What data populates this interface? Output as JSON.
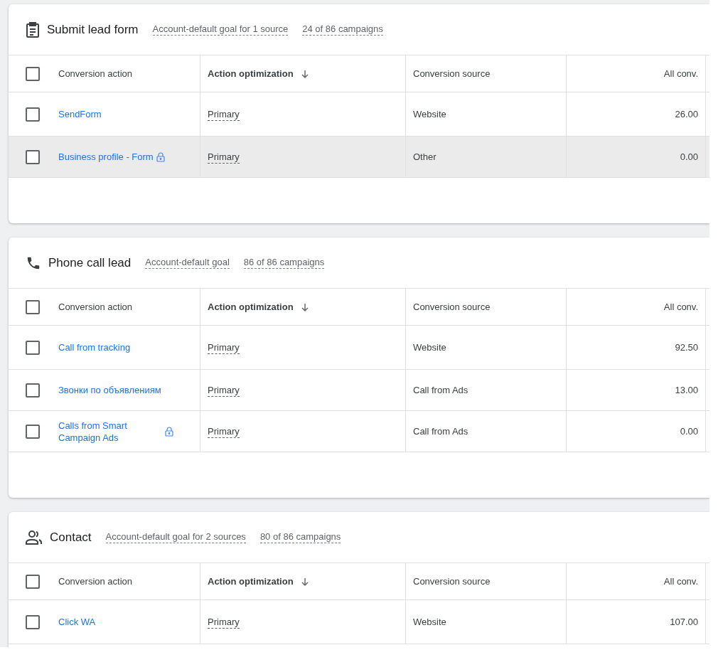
{
  "goals": [
    {
      "kind": "form",
      "title": "Submit lead form",
      "goal_scope": "Account-default goal for 1 source",
      "campaigns": "24 of 86 campaigns",
      "columns": [
        "Conversion action",
        "Action optimization",
        "Conversion source",
        "All conv."
      ],
      "all_checked": false,
      "rows": [
        {
          "action": "SendForm",
          "locked": false,
          "optimization": "Primary",
          "source": "Website",
          "all_conv": "26.00",
          "checked": false,
          "hovered": false
        },
        {
          "action": "Business profile - Form",
          "locked": true,
          "optimization": "Primary",
          "source": "Other",
          "all_conv": "0.00",
          "checked": false,
          "hovered": true
        }
      ]
    },
    {
      "kind": "phone",
      "title": "Phone call lead",
      "goal_scope": "Account-default goal",
      "campaigns": "86 of 86 campaigns",
      "columns": [
        "Conversion action",
        "Action optimization",
        "Conversion source",
        "All conv."
      ],
      "all_checked": false,
      "rows": [
        {
          "action": "Call from tracking",
          "locked": false,
          "optimization": "Primary",
          "source": "Website",
          "all_conv": "92.50",
          "checked": false,
          "hovered": false
        },
        {
          "action": "Звонки по объявлениям",
          "locked": false,
          "optimization": "Primary",
          "source": "Call from Ads",
          "all_conv": "13.00",
          "checked": false,
          "hovered": false
        },
        {
          "action": "Calls from Smart Campaign Ads",
          "locked": true,
          "optimization": "Primary",
          "source": "Call from Ads",
          "all_conv": "0.00",
          "checked": false,
          "hovered": false
        }
      ]
    },
    {
      "kind": "people",
      "title": "Contact",
      "goal_scope": "Account-default goal for 2 sources",
      "campaigns": "80 of 86 campaigns",
      "columns": [
        "Conversion action",
        "Action optimization",
        "Conversion source",
        "All conv."
      ],
      "all_checked": false,
      "rows": [
        {
          "action": "Click WA",
          "locked": false,
          "optimization": "Primary",
          "source": "Website",
          "all_conv": "107.00",
          "checked": false,
          "hovered": false
        }
      ]
    }
  ]
}
